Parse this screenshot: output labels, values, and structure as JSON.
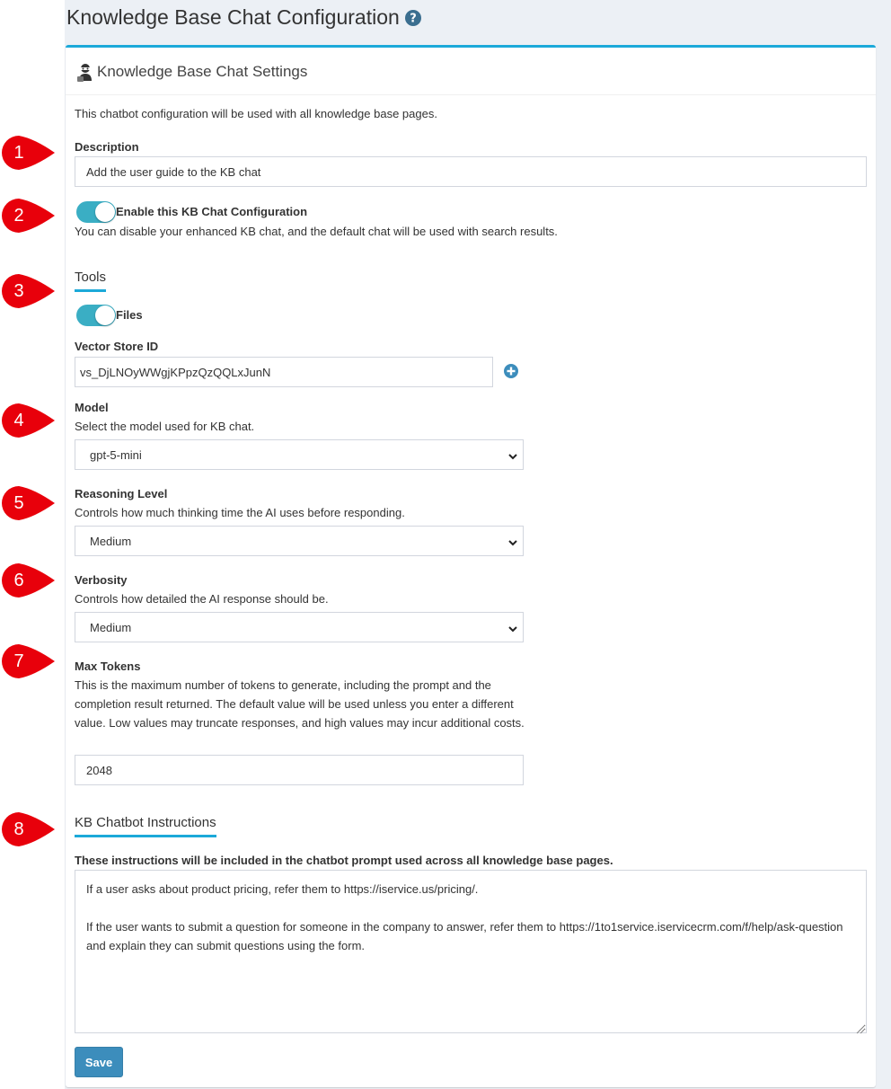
{
  "page": {
    "title": "Knowledge Base Chat Configuration"
  },
  "box": {
    "title": "Knowledge Base Chat Settings",
    "intro": "This chatbot configuration will be used with all knowledge base pages."
  },
  "description": {
    "label": "Description",
    "value": "Add the user guide to the KB chat"
  },
  "enable": {
    "label": "Enable this KB Chat Configuration",
    "help": "You can disable your enhanced KB chat, and the default chat will be used with search results.",
    "on": true
  },
  "tools": {
    "heading": "Tools",
    "files_label": "Files",
    "files_on": true
  },
  "vector_store": {
    "label": "Vector Store ID",
    "value": "vs_DjLNOyWWgjKPpzQzQQLxJunN"
  },
  "model": {
    "label": "Model",
    "help": "Select the model used for KB chat.",
    "selected": "gpt-5-mini"
  },
  "reasoning": {
    "label": "Reasoning Level",
    "help": "Controls how much thinking time the AI uses before responding.",
    "selected": "Medium"
  },
  "verbosity": {
    "label": "Verbosity",
    "help": "Controls how detailed the AI response should be.",
    "selected": "Medium"
  },
  "max_tokens": {
    "label": "Max Tokens",
    "help": "This is the maximum number of tokens to generate, including the prompt and the completion result returned. The default value will be used unless you enter a different value. Low values may truncate responses, and high values may incur additional costs.",
    "value": "2048"
  },
  "instructions": {
    "heading": "KB Chatbot Instructions",
    "label": "These instructions will be included in the chatbot prompt used across all knowledge base pages.",
    "value": "If a user asks about product pricing, refer them to https://iservice.us/pricing/.\n\nIf the user wants to submit a question for someone in the company to answer, refer them to https://1to1service.iservicecrm.com/f/help/ask-question and explain they can submit questions using the form."
  },
  "save_label": "Save",
  "markers": [
    "1",
    "2",
    "3",
    "4",
    "5",
    "6",
    "7",
    "8"
  ],
  "colors": {
    "accent": "#1ca9d9",
    "toggle": "#3aaec4",
    "button": "#3c8dbc",
    "marker": "#e8000b",
    "background": "#ecf0f5"
  }
}
